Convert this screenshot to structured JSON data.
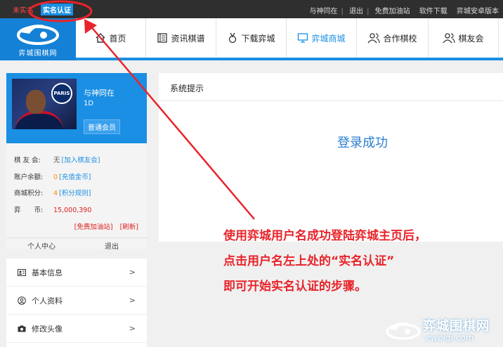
{
  "topbar": {
    "unverified": "未实名",
    "verify_button": "实名认证",
    "links": [
      "与神同在",
      "退出",
      "免费加油站",
      "软件下载",
      "弈城安卓版本"
    ]
  },
  "logo": {
    "text": "弈城围棋网"
  },
  "nav": {
    "items": [
      {
        "label": "首页",
        "icon": "home-icon"
      },
      {
        "label": "资讯棋谱",
        "icon": "book-icon"
      },
      {
        "label": "下载弈城",
        "icon": "medal-icon"
      },
      {
        "label": "弈城商城",
        "icon": "monitor-icon"
      },
      {
        "label": "合作棋校",
        "icon": "users-icon"
      },
      {
        "label": "棋友会",
        "icon": "user-group-icon"
      }
    ],
    "active_index": 3,
    "accent": "#1a8fe3"
  },
  "profile": {
    "username": "与神同在",
    "rank": "1D",
    "membership": "普通会员",
    "avatar_badge": "PARIS"
  },
  "info": {
    "club_label": "棋 友 会:",
    "club_value": "无",
    "club_link": "[加入棋友会]",
    "balance_label": "账户余额:",
    "balance_value": "0",
    "balance_link": "[充值金币]",
    "points_label": "商城积分:",
    "points_value": "4",
    "points_link": "[积分规则]",
    "coins_label": "弈　　币:",
    "coins_value": "15,000,390",
    "free_station_link": "[免费加油站]",
    "refresh_link": "[刷新]",
    "tab_personal": "个人中心",
    "tab_logout": "退出"
  },
  "menu": {
    "items": [
      {
        "label": "基本信息",
        "icon": "id-card-icon"
      },
      {
        "label": "个人资料",
        "icon": "user-circle-icon"
      },
      {
        "label": "修改头像",
        "icon": "camera-icon"
      }
    ],
    "arrow": ">"
  },
  "panel": {
    "title": "系统提示",
    "message": "登录成功"
  },
  "annotation": {
    "lines": [
      "使用弈城用户名成功登陆弈城主页后，",
      "点击用户名左上处的“实名认证”",
      "即可开始实名认证的步骤。"
    ],
    "color": "#e8242a"
  },
  "watermark": {
    "cn": "弈城围棋网",
    "en": "eweiqi.com"
  }
}
